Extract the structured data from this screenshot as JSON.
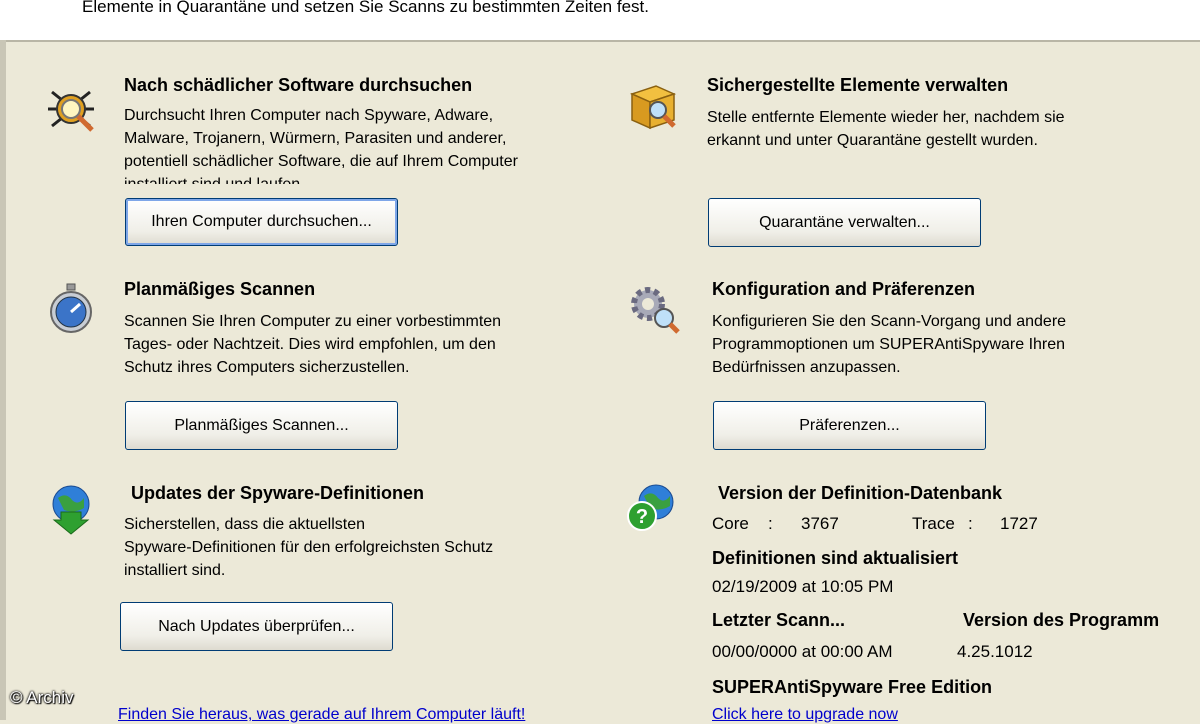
{
  "intro": "Elemente in Quarantäne und setzen Sie Scanns zu bestimmten Zeiten fest.",
  "scan": {
    "title": "Nach schädlicher Software durchsuchen",
    "lines": [
      "Durchsucht Ihren Computer nach Spyware, Adware,",
      "Malware, Trojanern, Würmern, Parasiten und anderer,",
      "potentiell schädlicher Software, die auf Ihrem Computer",
      "installiert sind und laufen."
    ],
    "button": "Ihren Computer durchsuchen..."
  },
  "quarantine": {
    "title": "Sichergestellte Elemente verwalten",
    "lines": [
      "Stelle entfernte Elemente wieder her, nachdem sie",
      "erkannt und unter Quarantäne gestellt wurden."
    ],
    "button": "Quarantäne verwalten..."
  },
  "schedule": {
    "title": "Planmäßiges Scannen",
    "lines": [
      "Scannen Sie Ihren Computer zu einer vorbestimmten",
      "Tages- oder Nachtzeit. Dies wird empfohlen, um den",
      "Schutz ihres Computers sicherzustellen."
    ],
    "button": "Planmäßiges Scannen..."
  },
  "config": {
    "title": "Konfiguration and Präferenzen",
    "lines": [
      "Konfigurieren Sie den Scann-Vorgang und andere",
      "Programmoptionen um SUPERAntiSpyware Ihren",
      "Bedürfnissen anzupassen."
    ],
    "button": "Präferenzen..."
  },
  "updates": {
    "title": "Updates der Spyware-Definitionen",
    "lines": [
      "Sicherstellen, dass die aktuellsten",
      "Spyware-Definitionen für den erfolgreichsten Schutz",
      "installiert sind."
    ],
    "button": "Nach Updates überprüfen..."
  },
  "info": {
    "title": "Version der Definition-Datenbank",
    "core_label": "Core",
    "sep": ":",
    "core_value": "3767",
    "trace_label": "Trace",
    "trace_value": "1727",
    "defs_title": "Definitionen sind aktualisiert",
    "defs_date": "02/19/2009 at 10:05 PM",
    "last_scan_title": "Letzter Scann...",
    "last_scan_value": "00/00/0000 at 00:00 AM",
    "program_version_title": "Version des Programm",
    "program_version_value": "4.25.1012",
    "edition": "SUPERAntiSpyware Free Edition",
    "upgrade_link": "Click here to upgrade now"
  },
  "bottom_link": "Finden Sie heraus, was gerade auf Ihrem Computer läuft!",
  "watermark": "© Archiv"
}
